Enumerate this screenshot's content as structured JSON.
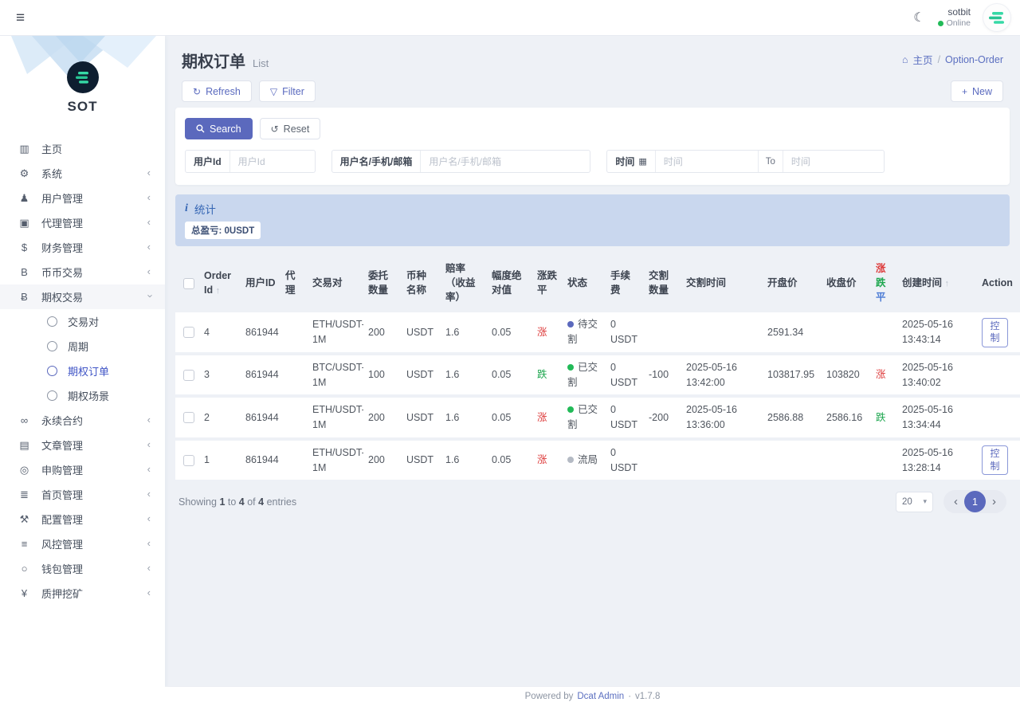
{
  "colors": {
    "primary": "#5b69bd",
    "up_red": "#dd3b3b",
    "down_green": "#1fa750",
    "banner_bg": "#c9d7ee"
  },
  "topbar": {
    "username": "sotbit",
    "status_label": "Online"
  },
  "brand": {
    "name": "SOT"
  },
  "sidebar": {
    "items": [
      {
        "id": "home",
        "glyph": "▥",
        "icon": "chart-bar",
        "label": "主页"
      },
      {
        "id": "system",
        "glyph": "⚙",
        "icon": "gear",
        "label": "系统",
        "arrow": "left"
      },
      {
        "id": "user-mgmt",
        "glyph": "♟",
        "icon": "user",
        "label": "用户管理",
        "arrow": "left"
      },
      {
        "id": "agent-mgmt",
        "glyph": "▣",
        "icon": "id-card",
        "label": "代理管理",
        "arrow": "left"
      },
      {
        "id": "finance-mgmt",
        "glyph": "$",
        "icon": "dollar",
        "label": "财务管理",
        "arrow": "left"
      },
      {
        "id": "spot-trade",
        "glyph": "B",
        "icon": "letter-b",
        "label": "币币交易",
        "arrow": "left"
      },
      {
        "id": "option-trade",
        "glyph": "Ƀ",
        "icon": "bitcoin",
        "label": "期权交易",
        "arrow": "down",
        "open": true,
        "children": [
          {
            "id": "trade-pair",
            "label": "交易对"
          },
          {
            "id": "period",
            "label": "周期"
          },
          {
            "id": "option-order",
            "label": "期权订单",
            "active": true
          },
          {
            "id": "option-scene",
            "label": "期权场景"
          }
        ]
      },
      {
        "id": "perpetual",
        "glyph": "∞",
        "icon": "link",
        "label": "永续合约",
        "arrow": "left"
      },
      {
        "id": "article-mgmt",
        "glyph": "▤",
        "icon": "newspaper",
        "label": "文章管理",
        "arrow": "left"
      },
      {
        "id": "subscribe-mgmt",
        "glyph": "◎",
        "icon": "life-ring",
        "label": "申购管理",
        "arrow": "left"
      },
      {
        "id": "homepage-mgmt",
        "glyph": "≣",
        "icon": "list",
        "label": "首页管理",
        "arrow": "left"
      },
      {
        "id": "config-mgmt",
        "glyph": "⚒",
        "icon": "wrench",
        "label": "配置管理",
        "arrow": "left"
      },
      {
        "id": "risk-mgmt",
        "glyph": "≡",
        "icon": "sliders",
        "label": "风控管理",
        "arrow": "left"
      },
      {
        "id": "wallet-mgmt",
        "glyph": "○",
        "icon": "circle",
        "label": "钱包管理",
        "arrow": "left"
      },
      {
        "id": "staking",
        "glyph": "¥",
        "icon": "yen",
        "label": "质押挖矿",
        "arrow": "left"
      }
    ]
  },
  "header": {
    "title": "期权订单",
    "subtitle": "List",
    "breadcrumb_home": "主页",
    "breadcrumb_sep": "/",
    "breadcrumb_current": "Option-Order"
  },
  "toolbar": {
    "refresh_label": "Refresh",
    "filter_label": "Filter",
    "new_plus": "+",
    "new_label": "New"
  },
  "search": {
    "search_label": "Search",
    "reset_label": "Reset",
    "user_id_label": "用户Id",
    "user_id_placeholder": "用户Id",
    "user_label": "用户名/手机/邮箱",
    "user_placeholder": "用户名/手机/邮箱",
    "time_label": "时间",
    "time_placeholder": "时间",
    "to_label": "To",
    "time2_placeholder": "时间"
  },
  "stats": {
    "title": "统计",
    "badge": "总盈亏: 0USDT"
  },
  "table": {
    "headers": [
      {
        "text": "Order Id",
        "sort": "↑"
      },
      {
        "text": "用户ID"
      },
      {
        "text": "代理"
      },
      {
        "text": "交易对"
      },
      {
        "text": "委托数量"
      },
      {
        "text": "币种名称"
      },
      {
        "text": "赔率（收益率）"
      },
      {
        "text": "幅度绝对值"
      },
      {
        "text": "涨跌平"
      },
      {
        "text": "状态"
      },
      {
        "text": "手续费"
      },
      {
        "text": "交割数量"
      },
      {
        "text": "交割时间"
      },
      {
        "text": "开盘价"
      },
      {
        "text": "收盘价"
      },
      {
        "parts": [
          {
            "t": "涨",
            "c": "red"
          },
          {
            "t": "跌",
            "c": "green"
          },
          {
            "t": "平",
            "c": "blue"
          }
        ]
      },
      {
        "text": "创建时间",
        "sort": "↑"
      },
      {
        "text": "Action"
      }
    ],
    "rows": [
      {
        "order_id": "4",
        "user_id": "861944",
        "agent": "",
        "pair": "ETH/USDT-1M",
        "amount": "200",
        "coin": "USDT",
        "odds": "1.6",
        "amplitude": "0.05",
        "direction": {
          "text": "涨",
          "color": "red"
        },
        "status": {
          "text": "待交割",
          "color": "blue"
        },
        "fee": "0 USDT",
        "settle_amount": "",
        "settle_time": "",
        "open_price": "2591.34",
        "close_price": "",
        "result": {
          "text": "",
          "color": ""
        },
        "created": "2025-05-16 13:43:14",
        "action_label": "控制"
      },
      {
        "order_id": "3",
        "user_id": "861944",
        "agent": "",
        "pair": "BTC/USDT-1M",
        "amount": "100",
        "coin": "USDT",
        "odds": "1.6",
        "amplitude": "0.05",
        "direction": {
          "text": "跌",
          "color": "green"
        },
        "status": {
          "text": "已交割",
          "color": "green"
        },
        "fee": "0 USDT",
        "settle_amount": "-100",
        "settle_time": "2025-05-16 13:42:00",
        "open_price": "103817.95",
        "close_price": "103820",
        "result": {
          "text": "涨",
          "color": "red"
        },
        "created": "2025-05-16 13:40:02",
        "action_label": ""
      },
      {
        "order_id": "2",
        "user_id": "861944",
        "agent": "",
        "pair": "ETH/USDT-1M",
        "amount": "200",
        "coin": "USDT",
        "odds": "1.6",
        "amplitude": "0.05",
        "direction": {
          "text": "涨",
          "color": "red"
        },
        "status": {
          "text": "已交割",
          "color": "green"
        },
        "fee": "0 USDT",
        "settle_amount": "-200",
        "settle_time": "2025-05-16 13:36:00",
        "open_price": "2586.88",
        "close_price": "2586.16",
        "result": {
          "text": "跌",
          "color": "green"
        },
        "created": "2025-05-16 13:34:44",
        "action_label": ""
      },
      {
        "order_id": "1",
        "user_id": "861944",
        "agent": "",
        "pair": "ETH/USDT-1M",
        "amount": "200",
        "coin": "USDT",
        "odds": "1.6",
        "amplitude": "0.05",
        "direction": {
          "text": "涨",
          "color": "red"
        },
        "status": {
          "text": "流局",
          "color": "gray"
        },
        "fee": "0 USDT",
        "settle_amount": "",
        "settle_time": "",
        "open_price": "",
        "close_price": "",
        "result": {
          "text": "",
          "color": ""
        },
        "created": "2025-05-16 13:28:14",
        "action_label": "控制"
      }
    ]
  },
  "pagination": {
    "w_showing": "Showing",
    "w_to": "to",
    "w_of": "of",
    "w_entries": "entries",
    "from": "1",
    "to": "4",
    "total": "4",
    "page_size": "20",
    "prev": "‹",
    "page": "1",
    "next": "›"
  },
  "footer": {
    "powered": "Powered by",
    "brand": "Dcat Admin",
    "sep": "·",
    "version": "v1.7.8"
  }
}
